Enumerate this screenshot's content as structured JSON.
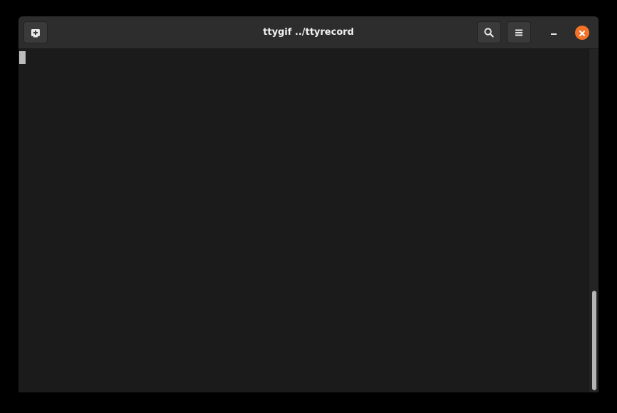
{
  "window": {
    "title": "ttygif ../ttyrecord"
  },
  "icons": {
    "new_tab": "new-tab-icon",
    "search": "search-icon",
    "menu": "hamburger-menu-icon",
    "minimize": "minimize-icon",
    "close": "close-icon"
  },
  "colors": {
    "close_accent": "#f37329",
    "terminal_background": "#1b1b1b",
    "headerbar_background": "#2d2d2d",
    "cursor": "#bdbdbd"
  },
  "terminal": {
    "content": ""
  }
}
